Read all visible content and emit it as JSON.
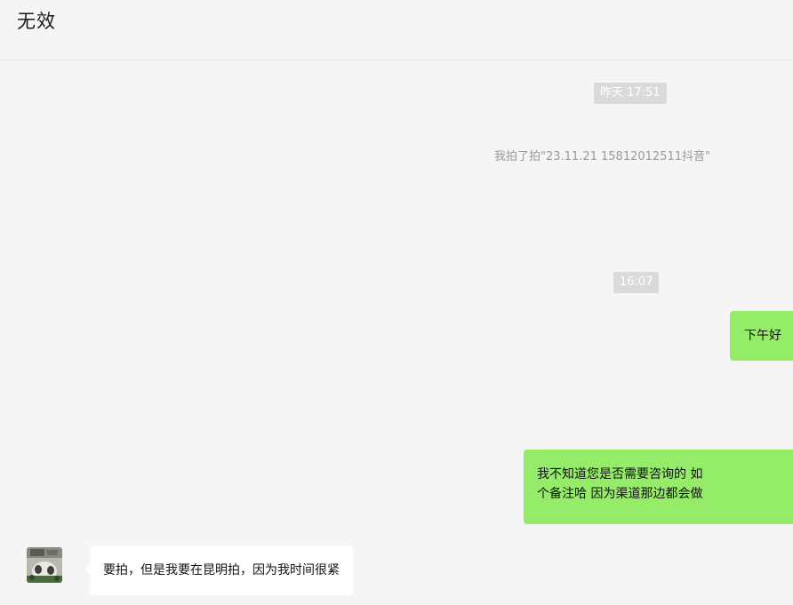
{
  "header": {
    "title": "无效"
  },
  "messages": {
    "timestamp_1": "昨天 17:51",
    "system_note": "我拍了拍\"23.11.21 15812012511抖音\"",
    "timestamp_2": "16:07",
    "mine_1": "下午好",
    "mine_2_line1": "我不知道您是否需要咨询的 如",
    "mine_2_line2": "个备注哈 因为渠道那边都会做",
    "theirs_1": "要拍，但是我要在昆明拍，因为我时间很紧"
  },
  "colors": {
    "background": "#f5f5f5",
    "mine_bubble": "#95ec69",
    "theirs_bubble": "#ffffff",
    "timestamp_bg": "#dadada"
  }
}
